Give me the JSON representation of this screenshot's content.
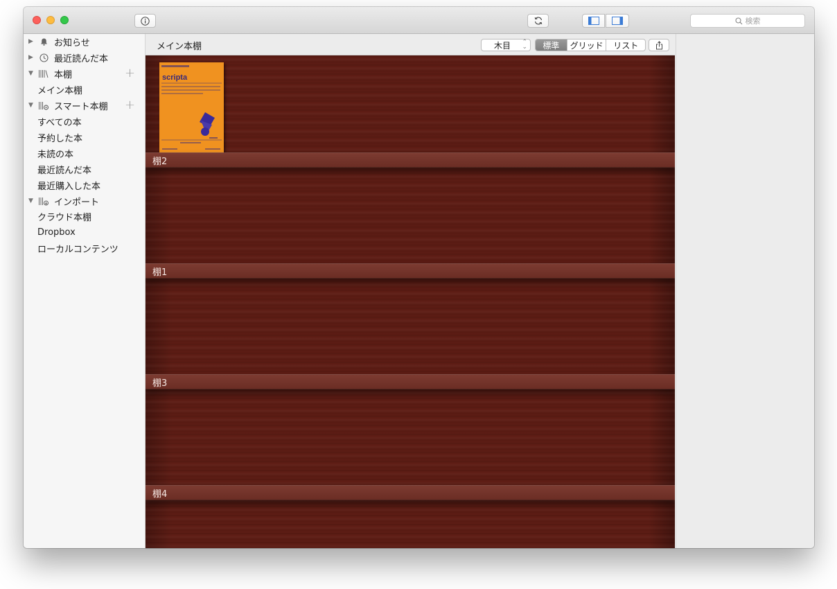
{
  "toolbar": {
    "info_icon": "info-icon",
    "sync_icon": "sync-icon",
    "search_placeholder": "検索"
  },
  "sidebar": {
    "sections": [
      {
        "label": "お知らせ",
        "icon": "bell-icon",
        "expanded": false
      },
      {
        "label": "最近読んだ本",
        "icon": "clock-icon",
        "expanded": false
      },
      {
        "label": "本棚",
        "icon": "bookshelf-icon",
        "expanded": true,
        "items": [
          "メイン本棚"
        ]
      },
      {
        "label": "スマート本棚",
        "icon": "smart-shelf-icon",
        "expanded": true,
        "items": [
          "すべての本",
          "予約した本",
          "未読の本",
          "最近読んだ本",
          "最近購入した本"
        ]
      },
      {
        "label": "インポート",
        "icon": "import-icon",
        "expanded": true,
        "items": [
          "クラウド本棚",
          "Dropbox",
          "ローカルコンテンツ"
        ]
      }
    ]
  },
  "main": {
    "title": "メイン本棚",
    "theme_select": "木目",
    "view_modes": [
      "標準",
      "グリッド",
      "リスト"
    ],
    "active_view": "標準",
    "shelves": [
      "棚2",
      "棚1",
      "棚3",
      "棚4"
    ],
    "book": {
      "title": "scripta"
    }
  },
  "colors": {
    "wood": "#5d1c14",
    "book_cover": "#f09220",
    "accent_blue": "#3a7bd5"
  }
}
